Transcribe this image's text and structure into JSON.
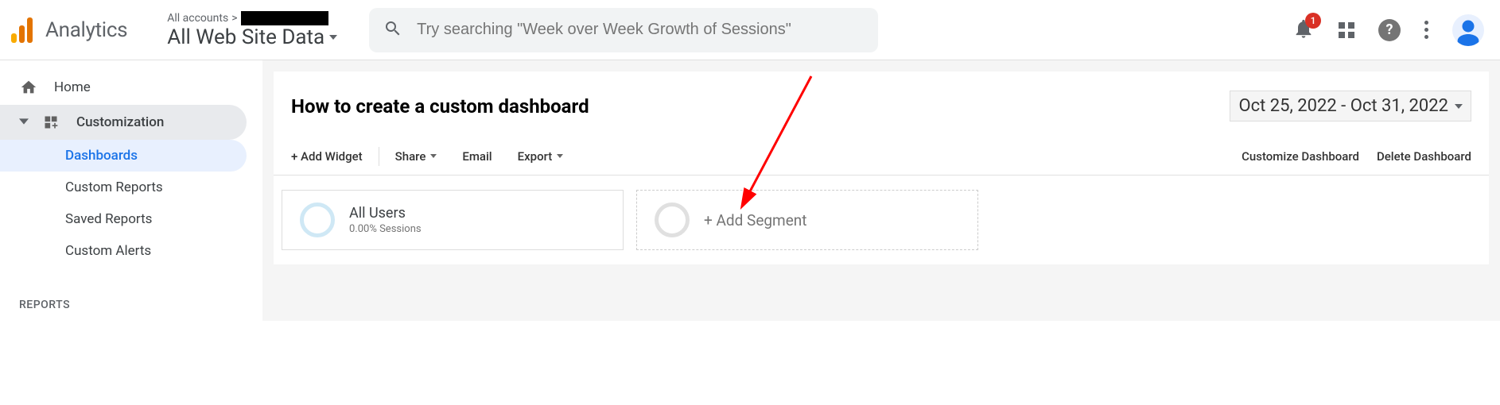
{
  "header": {
    "product_name": "Analytics",
    "breadcrumb_prefix": "All accounts",
    "breadcrumb_separator": ">",
    "view_name": "All Web Site Data",
    "search_placeholder": "Try searching \"Week over Week Growth of Sessions\"",
    "notification_count": "1"
  },
  "sidebar": {
    "home": "Home",
    "customization": "Customization",
    "sub": {
      "dashboards": "Dashboards",
      "custom_reports": "Custom Reports",
      "saved_reports": "Saved Reports",
      "custom_alerts": "Custom Alerts"
    },
    "reports_label": "REPORTS"
  },
  "dashboard": {
    "title": "How to create a custom dashboard",
    "date_range": "Oct 25, 2022 - Oct 31, 2022",
    "toolbar": {
      "add_widget": "+ Add Widget",
      "share": "Share",
      "email": "Email",
      "export": "Export",
      "customize": "Customize Dashboard",
      "delete": "Delete Dashboard"
    },
    "segments": {
      "all_users": "All Users",
      "all_users_sub": "0.00% Sessions",
      "add_segment": "+ Add Segment"
    }
  }
}
